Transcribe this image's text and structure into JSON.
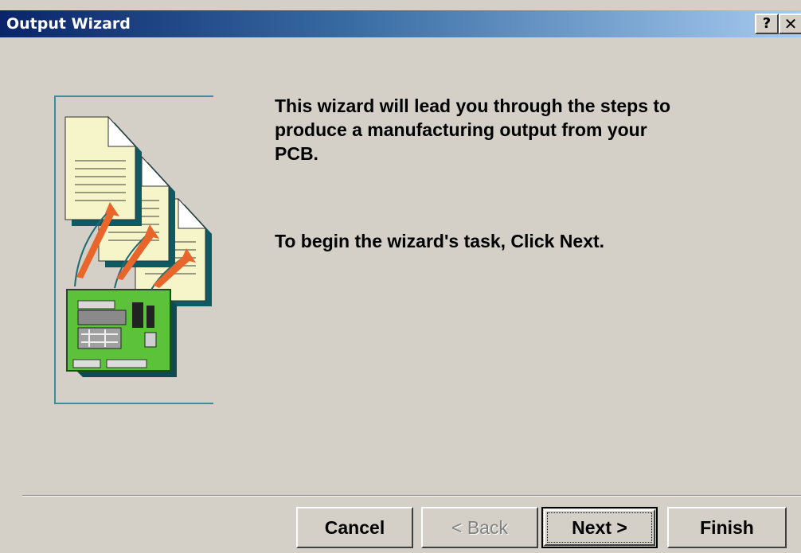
{
  "window": {
    "title": "Output Wizard",
    "help_label": "?",
    "close_label": "✕"
  },
  "content": {
    "intro_text": "This wizard will lead you through the steps to\nproduce a manufacturing output from your\nPCB.",
    "begin_text": "To begin the wizard's task, Click Next."
  },
  "buttons": {
    "cancel": "Cancel",
    "back": "< Back",
    "next": "Next >",
    "finish": "Finish"
  },
  "states": {
    "back_enabled": false,
    "next_default": true
  },
  "colors": {
    "titlebar_start": "#0a246a",
    "titlebar_end": "#a6caf0",
    "dialog_face": "#d4d0c8",
    "frame_accent": "#3e8e9a"
  }
}
